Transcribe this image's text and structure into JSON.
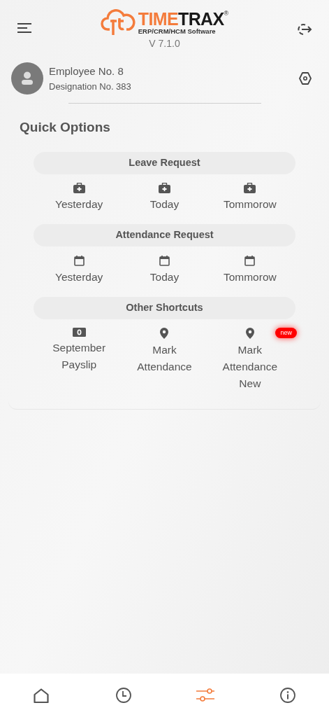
{
  "header": {
    "logo_primary": "TIME",
    "logo_secondary": "TRAX",
    "logo_mark": "®",
    "logo_tagline": "ERP/CRM/HCM Software",
    "version": "V 7.1.0"
  },
  "profile": {
    "name": "Employee No. 8",
    "designation": "Designation No. 383"
  },
  "quick_options": {
    "title": "Quick Options",
    "sections": [
      {
        "title": "Leave Request",
        "items": [
          {
            "kind": "medical",
            "label": "Yesterday"
          },
          {
            "kind": "medical",
            "label": "Today"
          },
          {
            "kind": "medical",
            "label": "Tommorow"
          }
        ]
      },
      {
        "title": "Attendance Request",
        "items": [
          {
            "kind": "calendar",
            "label": "Yesterday"
          },
          {
            "kind": "calendar",
            "label": "Today"
          },
          {
            "kind": "calendar",
            "label": "Tommorow"
          }
        ]
      },
      {
        "title": "Other Shortcuts",
        "items": [
          {
            "kind": "money",
            "label": "September Payslip"
          },
          {
            "kind": "pin",
            "label": "Mark Attendance"
          },
          {
            "kind": "pin",
            "label": "Mark Attendance New",
            "badge": "new"
          }
        ]
      }
    ]
  },
  "bottom_nav": [
    {
      "kind": "home",
      "selected": false
    },
    {
      "kind": "clock",
      "selected": false
    },
    {
      "kind": "sliders",
      "selected": true
    },
    {
      "kind": "info",
      "selected": false
    }
  ]
}
